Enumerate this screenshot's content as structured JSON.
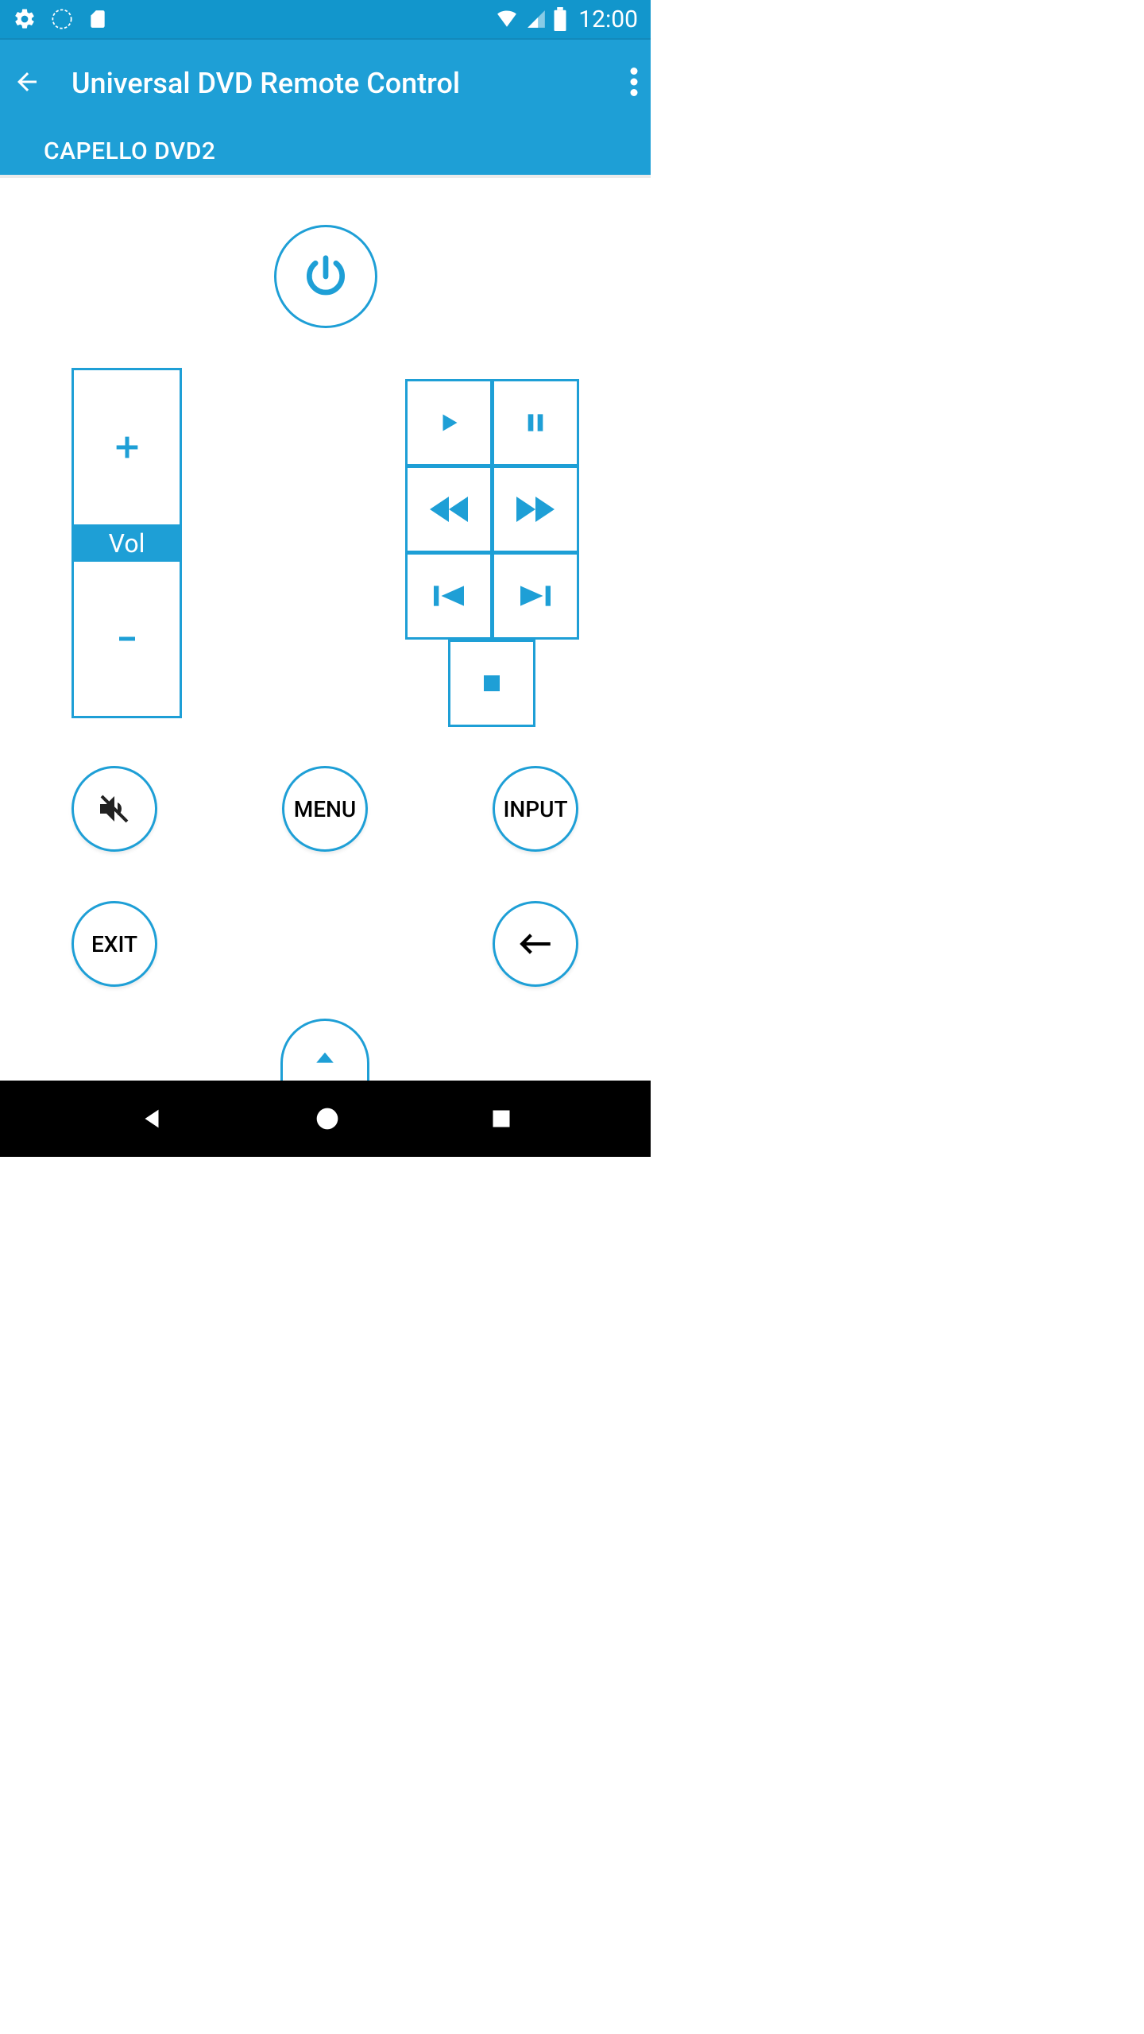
{
  "status": {
    "time": "12:00"
  },
  "appbar": {
    "title": "Universal DVD Remote Control"
  },
  "tab": {
    "label": "CAPELLO DVD2"
  },
  "volume": {
    "label": "Vol"
  },
  "buttons": {
    "menu": "MENU",
    "input": "INPUT",
    "exit": "EXIT"
  }
}
